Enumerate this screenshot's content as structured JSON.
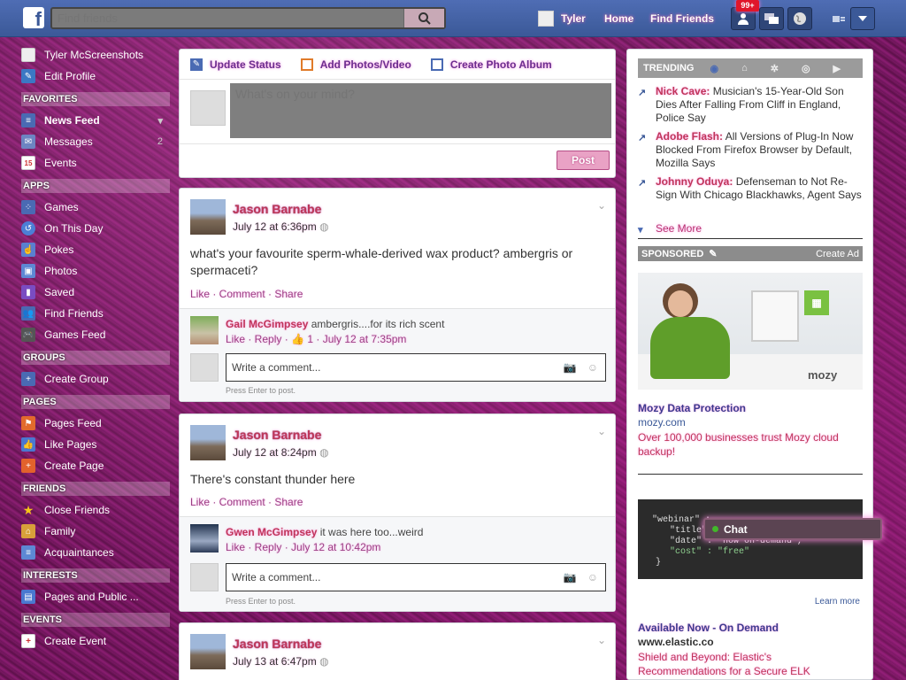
{
  "header": {
    "logo_letter": "f",
    "search_placeholder": "Find friends",
    "user_name": "Tyler",
    "home_label": "Home",
    "find_friends_label": "Find Friends",
    "notif_count": "99+"
  },
  "sidebar": {
    "profile_name": "Tyler McScreenshots",
    "edit_profile": "Edit Profile",
    "favorites_head": "FAVORITES",
    "favorites": [
      {
        "label": "News Feed",
        "icon": "news-feed-icon",
        "count": ""
      },
      {
        "label": "Messages",
        "icon": "messages-icon",
        "count": "2"
      },
      {
        "label": "Events",
        "icon": "calendar-icon",
        "count": "",
        "icon_text": "15"
      }
    ],
    "apps_head": "APPS",
    "apps": [
      {
        "label": "Games",
        "icon": "games-icon"
      },
      {
        "label": "On This Day",
        "icon": "on-this-day-icon"
      },
      {
        "label": "Pokes",
        "icon": "pokes-icon"
      },
      {
        "label": "Photos",
        "icon": "photos-icon"
      },
      {
        "label": "Saved",
        "icon": "saved-icon"
      },
      {
        "label": "Find Friends",
        "icon": "find-friends-icon"
      },
      {
        "label": "Games Feed",
        "icon": "games-feed-icon"
      }
    ],
    "groups_head": "GROUPS",
    "groups": [
      {
        "label": "Create Group",
        "icon": "create-group-icon"
      }
    ],
    "pages_head": "PAGES",
    "pages": [
      {
        "label": "Pages Feed",
        "icon": "pages-feed-icon"
      },
      {
        "label": "Like Pages",
        "icon": "like-pages-icon"
      },
      {
        "label": "Create Page",
        "icon": "create-page-icon"
      }
    ],
    "friends_head": "FRIENDS",
    "friends": [
      {
        "label": "Close Friends",
        "icon": "star-icon"
      },
      {
        "label": "Family",
        "icon": "family-icon"
      },
      {
        "label": "Acquaintances",
        "icon": "acquaintances-icon"
      }
    ],
    "interests_head": "INTERESTS",
    "interests": [
      {
        "label": "Pages and Public ...",
        "icon": "interests-icon"
      }
    ],
    "events_head": "EVENTS",
    "events": [
      {
        "label": "Create Event",
        "icon": "create-event-icon"
      }
    ]
  },
  "composer": {
    "tabs": [
      "Update Status",
      "Add Photos/Video",
      "Create Photo Album"
    ],
    "placeholder": "What's on your mind?",
    "post_button": "Post"
  },
  "posts": [
    {
      "author": "Jason Barnabe",
      "time": "July 12 at 6:36pm",
      "text": "what's your favourite sperm-whale-derived wax product? ambergris or spermaceti?",
      "actions": "Like · Comment · Share",
      "comment_author": "Gail McGimpsey",
      "comment_text": "ambergris....for its rich scent",
      "comment_meta": "Like · Reply ·",
      "comment_likes": "1",
      "comment_time": "· July 12 at 7:35pm",
      "write_comment": "Write a comment...",
      "press_enter": "Press Enter to post."
    },
    {
      "author": "Jason Barnabe",
      "time": "July 12 at 8:24pm",
      "text": "There's constant thunder here",
      "actions": "Like · Comment · Share",
      "comment_author": "Gwen McGimpsey",
      "comment_text": "it was here too...weird",
      "comment_meta": "Like · Reply · July 12 at 10:42pm",
      "write_comment": "Write a comment...",
      "press_enter": "Press Enter to post."
    },
    {
      "author": "Jason Barnabe",
      "time": "July 13 at 6:47pm"
    }
  ],
  "trending": {
    "head": "TRENDING",
    "items": [
      {
        "name": "Nick Cave:",
        "text": "Musician's 15-Year-Old Son Dies After Falling From Cliff in England, Police Say"
      },
      {
        "name": "Adobe Flash:",
        "text": "All Versions of Plug-In Now Blocked From Firefox Browser by Default, Mozilla Says"
      },
      {
        "name": "Johnny Oduya:",
        "text": "Defenseman to Not Re-Sign With Chicago Blackhawks, Agent Says"
      }
    ],
    "see_more": "See More"
  },
  "sponsored": {
    "head": "SPONSORED",
    "create_ad": "Create Ad",
    "ad1": {
      "brand": "mozy",
      "title": "Mozy Data Protection",
      "url": "mozy.com",
      "body": "Over 100,000 businesses trust Mozy cloud backup!"
    },
    "ad2": {
      "code_lines": [
        "\"webinar\" :",
        "\"title\" :",
        "\"date\" :  \"now on-demand\",",
        "\"cost\"  :  \"free\"",
        "}"
      ],
      "learn_more": "Learn more",
      "title": "Available Now - On Demand",
      "url": "www.elastic.co",
      "body": "Shield and Beyond: Elastic's Recommendations for a Secure ELK"
    }
  },
  "chat": {
    "label": "Chat"
  }
}
